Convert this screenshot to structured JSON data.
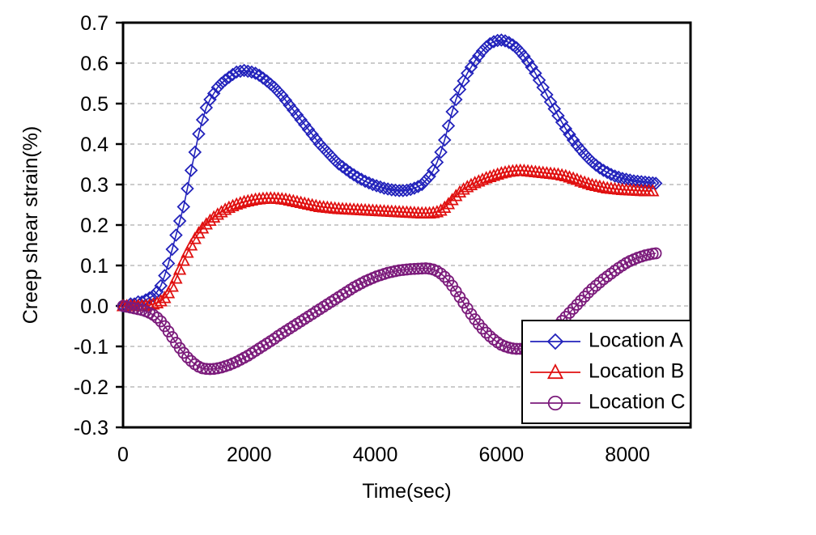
{
  "chart_data": {
    "type": "line",
    "title": "",
    "xlabel": "Time(sec)",
    "ylabel": "Creep shear strain(%)",
    "xlim": [
      0,
      9000
    ],
    "ylim": [
      -0.3,
      0.7
    ],
    "xticks": [
      "0",
      "2000",
      "4000",
      "6000",
      "8000"
    ],
    "xtick_values": [
      0,
      2000,
      4000,
      6000,
      8000
    ],
    "yticks": [
      "-0.3",
      "-0.2",
      "-0.1",
      "0.0",
      "0.1",
      "0.2",
      "0.3",
      "0.4",
      "0.5",
      "0.6",
      "0.7"
    ],
    "ytick_values": [
      -0.3,
      -0.2,
      -0.1,
      0.0,
      0.1,
      0.2,
      0.3,
      0.4,
      0.5,
      0.6,
      0.7
    ],
    "grid": "horizontal",
    "legend_position": "lower-right",
    "series": [
      {
        "name": "Location A",
        "color": "#2222bb",
        "marker": "diamond",
        "x": [
          0,
          60,
          120,
          180,
          240,
          300,
          360,
          420,
          480,
          540,
          600,
          660,
          720,
          780,
          840,
          900,
          960,
          1020,
          1080,
          1140,
          1200,
          1260,
          1320,
          1380,
          1440,
          1500,
          1560,
          1620,
          1680,
          1740,
          1800,
          1860,
          1920,
          1980,
          2040,
          2100,
          2160,
          2220,
          2280,
          2340,
          2400,
          2460,
          2520,
          2580,
          2640,
          2700,
          2760,
          2820,
          2880,
          2940,
          3000,
          3060,
          3120,
          3180,
          3240,
          3300,
          3360,
          3420,
          3480,
          3540,
          3600,
          3660,
          3720,
          3780,
          3840,
          3900,
          3960,
          4020,
          4080,
          4140,
          4200,
          4260,
          4320,
          4380,
          4440,
          4500,
          4560,
          4620,
          4680,
          4740,
          4800,
          4860,
          4920,
          4980,
          5040,
          5100,
          5160,
          5220,
          5280,
          5340,
          5400,
          5460,
          5520,
          5580,
          5640,
          5700,
          5760,
          5820,
          5880,
          5940,
          6000,
          6060,
          6120,
          6180,
          6240,
          6300,
          6360,
          6420,
          6480,
          6540,
          6600,
          6660,
          6720,
          6780,
          6840,
          6900,
          6960,
          7020,
          7080,
          7140,
          7200,
          7260,
          7320,
          7380,
          7440,
          7500,
          7560,
          7620,
          7680,
          7740,
          7800,
          7860,
          7920,
          7980,
          8040,
          8100,
          8160,
          8220,
          8280,
          8340,
          8400,
          8450
        ],
        "y": [
          0.0,
          0.0,
          0.005,
          0.005,
          0.01,
          0.01,
          0.015,
          0.02,
          0.025,
          0.035,
          0.05,
          0.075,
          0.105,
          0.14,
          0.175,
          0.21,
          0.245,
          0.29,
          0.335,
          0.38,
          0.425,
          0.46,
          0.49,
          0.51,
          0.525,
          0.54,
          0.55,
          0.558,
          0.565,
          0.572,
          0.578,
          0.58,
          0.582,
          0.58,
          0.578,
          0.575,
          0.57,
          0.563,
          0.556,
          0.548,
          0.54,
          0.53,
          0.52,
          0.508,
          0.496,
          0.484,
          0.472,
          0.46,
          0.448,
          0.436,
          0.424,
          0.412,
          0.4,
          0.39,
          0.38,
          0.37,
          0.36,
          0.351,
          0.344,
          0.337,
          0.33,
          0.324,
          0.318,
          0.313,
          0.308,
          0.304,
          0.3,
          0.297,
          0.294,
          0.291,
          0.289,
          0.287,
          0.286,
          0.285,
          0.285,
          0.286,
          0.288,
          0.291,
          0.295,
          0.3,
          0.31,
          0.32,
          0.335,
          0.355,
          0.38,
          0.41,
          0.445,
          0.48,
          0.51,
          0.535,
          0.556,
          0.575,
          0.59,
          0.605,
          0.618,
          0.63,
          0.64,
          0.648,
          0.653,
          0.656,
          0.657,
          0.655,
          0.651,
          0.645,
          0.638,
          0.628,
          0.617,
          0.604,
          0.59,
          0.575,
          0.558,
          0.54,
          0.522,
          0.504,
          0.487,
          0.47,
          0.454,
          0.438,
          0.424,
          0.41,
          0.397,
          0.386,
          0.375,
          0.365,
          0.356,
          0.348,
          0.341,
          0.335,
          0.33,
          0.325,
          0.321,
          0.318,
          0.315,
          0.313,
          0.311,
          0.309,
          0.308,
          0.307,
          0.306,
          0.305,
          0.304,
          0.303,
          0.302
        ]
      },
      {
        "name": "Location B",
        "color": "#e01010",
        "marker": "triangle",
        "x": [
          0,
          60,
          120,
          180,
          240,
          300,
          360,
          420,
          480,
          540,
          600,
          660,
          720,
          780,
          840,
          900,
          960,
          1020,
          1080,
          1140,
          1200,
          1260,
          1320,
          1380,
          1440,
          1500,
          1560,
          1620,
          1680,
          1740,
          1800,
          1860,
          1920,
          1980,
          2040,
          2100,
          2160,
          2220,
          2280,
          2340,
          2400,
          2460,
          2520,
          2580,
          2640,
          2700,
          2760,
          2820,
          2880,
          2940,
          3000,
          3060,
          3120,
          3180,
          3240,
          3300,
          3360,
          3420,
          3480,
          3540,
          3600,
          3660,
          3720,
          3780,
          3840,
          3900,
          3960,
          4020,
          4080,
          4140,
          4200,
          4260,
          4320,
          4380,
          4440,
          4500,
          4560,
          4620,
          4680,
          4740,
          4800,
          4860,
          4920,
          4980,
          5040,
          5100,
          5160,
          5220,
          5280,
          5340,
          5400,
          5460,
          5520,
          5580,
          5640,
          5700,
          5760,
          5820,
          5880,
          5940,
          6000,
          6060,
          6120,
          6180,
          6240,
          6300,
          6360,
          6420,
          6480,
          6540,
          6600,
          6660,
          6720,
          6780,
          6840,
          6900,
          6960,
          7020,
          7080,
          7140,
          7200,
          7260,
          7320,
          7380,
          7440,
          7500,
          7560,
          7620,
          7680,
          7740,
          7800,
          7860,
          7920,
          7980,
          8040,
          8100,
          8160,
          8220,
          8280,
          8340,
          8400,
          8450
        ],
        "y": [
          0.0,
          0.0,
          0.0,
          0.0,
          0.0,
          0.0,
          0.0,
          0.002,
          0.004,
          0.007,
          0.012,
          0.02,
          0.032,
          0.048,
          0.068,
          0.09,
          0.112,
          0.132,
          0.15,
          0.166,
          0.18,
          0.192,
          0.202,
          0.211,
          0.219,
          0.226,
          0.232,
          0.238,
          0.243,
          0.247,
          0.251,
          0.254,
          0.257,
          0.259,
          0.261,
          0.263,
          0.264,
          0.265,
          0.2655,
          0.266,
          0.2655,
          0.265,
          0.264,
          0.263,
          0.261,
          0.259,
          0.257,
          0.255,
          0.253,
          0.251,
          0.249,
          0.247,
          0.245,
          0.244,
          0.243,
          0.242,
          0.241,
          0.24,
          0.2395,
          0.239,
          0.2385,
          0.238,
          0.2375,
          0.237,
          0.2365,
          0.236,
          0.2355,
          0.235,
          0.2345,
          0.234,
          0.2335,
          0.233,
          0.2325,
          0.232,
          0.2315,
          0.231,
          0.2305,
          0.23,
          0.2295,
          0.229,
          0.229,
          0.229,
          0.23,
          0.232,
          0.236,
          0.243,
          0.252,
          0.262,
          0.272,
          0.281,
          0.288,
          0.294,
          0.299,
          0.304,
          0.308,
          0.312,
          0.316,
          0.319,
          0.322,
          0.325,
          0.328,
          0.33,
          0.332,
          0.333,
          0.334,
          0.3345,
          0.334,
          0.333,
          0.332,
          0.331,
          0.33,
          0.329,
          0.328,
          0.327,
          0.326,
          0.325,
          0.323,
          0.321,
          0.318,
          0.315,
          0.312,
          0.308,
          0.305,
          0.302,
          0.299,
          0.297,
          0.295,
          0.293,
          0.291,
          0.29,
          0.289,
          0.288,
          0.287,
          0.2865,
          0.286,
          0.2855,
          0.285,
          0.2845,
          0.284,
          0.284,
          0.284
        ]
      },
      {
        "name": "Location C",
        "color": "#7b1b7b",
        "marker": "circle",
        "x": [
          0,
          60,
          120,
          180,
          240,
          300,
          360,
          420,
          480,
          540,
          600,
          660,
          720,
          780,
          840,
          900,
          960,
          1020,
          1080,
          1140,
          1200,
          1260,
          1320,
          1380,
          1440,
          1500,
          1560,
          1620,
          1680,
          1740,
          1800,
          1860,
          1920,
          1980,
          2040,
          2100,
          2160,
          2220,
          2280,
          2340,
          2400,
          2460,
          2520,
          2580,
          2640,
          2700,
          2760,
          2820,
          2880,
          2940,
          3000,
          3060,
          3120,
          3180,
          3240,
          3300,
          3360,
          3420,
          3480,
          3540,
          3600,
          3660,
          3720,
          3780,
          3840,
          3900,
          3960,
          4020,
          4080,
          4140,
          4200,
          4260,
          4320,
          4380,
          4440,
          4500,
          4560,
          4620,
          4680,
          4740,
          4800,
          4860,
          4920,
          4980,
          5040,
          5100,
          5160,
          5220,
          5280,
          5340,
          5400,
          5460,
          5520,
          5580,
          5640,
          5700,
          5760,
          5820,
          5880,
          5940,
          6000,
          6060,
          6120,
          6180,
          6240,
          6300,
          6360,
          6420,
          6480,
          6540,
          6600,
          6660,
          6720,
          6780,
          6840,
          6900,
          6960,
          7020,
          7080,
          7140,
          7200,
          7260,
          7320,
          7380,
          7440,
          7500,
          7560,
          7620,
          7680,
          7740,
          7800,
          7860,
          7920,
          7980,
          8040,
          8100,
          8160,
          8220,
          8280,
          8340,
          8400,
          8450
        ],
        "y": [
          0.0,
          -0.002,
          -0.004,
          -0.006,
          -0.008,
          -0.01,
          -0.013,
          -0.017,
          -0.022,
          -0.029,
          -0.038,
          -0.05,
          -0.063,
          -0.077,
          -0.091,
          -0.104,
          -0.116,
          -0.127,
          -0.136,
          -0.144,
          -0.15,
          -0.154,
          -0.1555,
          -0.156,
          -0.1555,
          -0.154,
          -0.152,
          -0.149,
          -0.146,
          -0.142,
          -0.138,
          -0.133,
          -0.128,
          -0.123,
          -0.117,
          -0.111,
          -0.105,
          -0.099,
          -0.093,
          -0.087,
          -0.081,
          -0.074,
          -0.068,
          -0.062,
          -0.056,
          -0.05,
          -0.044,
          -0.038,
          -0.032,
          -0.026,
          -0.02,
          -0.014,
          -0.008,
          -0.002,
          0.004,
          0.01,
          0.016,
          0.022,
          0.028,
          0.034,
          0.04,
          0.046,
          0.051,
          0.056,
          0.061,
          0.065,
          0.069,
          0.073,
          0.076,
          0.079,
          0.082,
          0.084,
          0.086,
          0.088,
          0.089,
          0.09,
          0.091,
          0.0915,
          0.092,
          0.0925,
          0.093,
          0.092,
          0.09,
          0.086,
          0.08,
          0.072,
          0.062,
          0.05,
          0.036,
          0.022,
          0.008,
          -0.006,
          -0.02,
          -0.033,
          -0.045,
          -0.056,
          -0.066,
          -0.075,
          -0.083,
          -0.09,
          -0.096,
          -0.1,
          -0.103,
          -0.105,
          -0.106,
          -0.106,
          -0.105,
          -0.103,
          -0.1,
          -0.096,
          -0.09,
          -0.083,
          -0.075,
          -0.066,
          -0.057,
          -0.047,
          -0.037,
          -0.027,
          -0.017,
          -0.007,
          0.003,
          0.013,
          0.023,
          0.033,
          0.042,
          0.05,
          0.058,
          0.066,
          0.073,
          0.08,
          0.087,
          0.094,
          0.1,
          0.106,
          0.111,
          0.115,
          0.119,
          0.122,
          0.125,
          0.127,
          0.129,
          0.13,
          0.131
        ]
      }
    ]
  },
  "legend": {
    "items": [
      {
        "label": "Location A",
        "color": "#2222bb",
        "marker": "diamond"
      },
      {
        "label": "Location B",
        "color": "#e01010",
        "marker": "triangle"
      },
      {
        "label": "Location C",
        "color": "#7b1b7b",
        "marker": "circle"
      }
    ]
  }
}
